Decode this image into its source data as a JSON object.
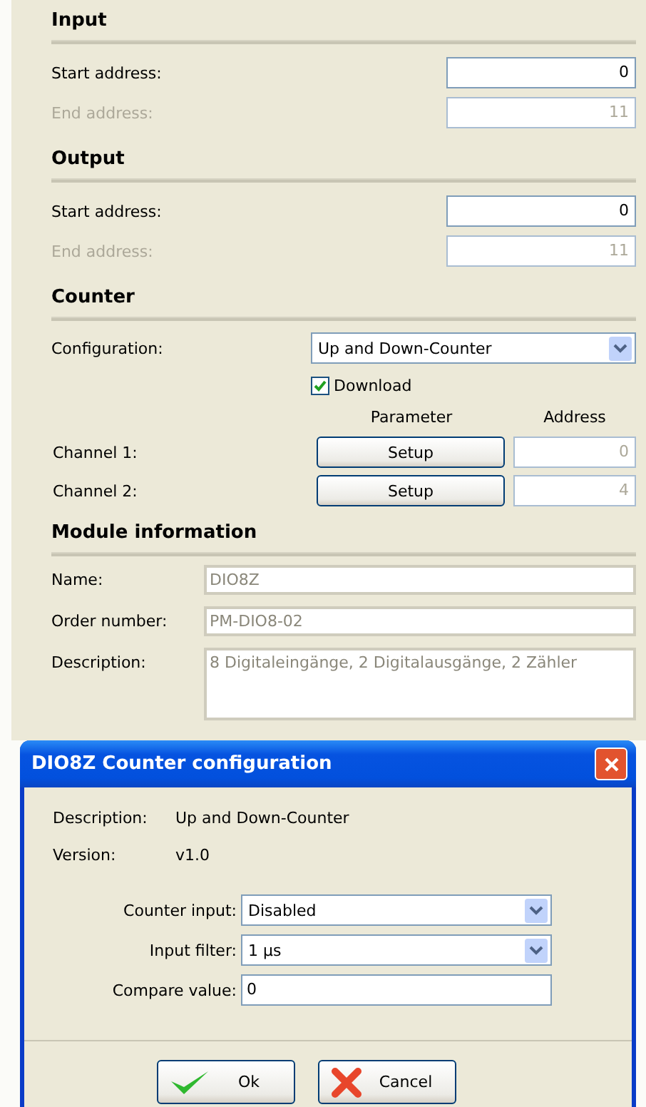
{
  "input": {
    "title": "Input",
    "rows": [
      {
        "label": "Start address:",
        "value": "0",
        "disabled": false
      },
      {
        "label": "End address:",
        "value": "11",
        "disabled": true
      }
    ]
  },
  "output": {
    "title": "Output",
    "rows": [
      {
        "label": "Start address:",
        "value": "0",
        "disabled": false
      },
      {
        "label": "End address:",
        "value": "11",
        "disabled": true
      }
    ]
  },
  "counter": {
    "title": "Counter",
    "configuration": {
      "label": "Configuration:",
      "value": "Up and Down-Counter"
    },
    "download": {
      "label": "Download",
      "checked": true
    },
    "headers": [
      "Parameter",
      "Address"
    ],
    "channels": [
      {
        "label": "Channel 1:",
        "button": "Setup",
        "address": "0"
      },
      {
        "label": "Channel 2:",
        "button": "Setup",
        "address": "4"
      }
    ]
  },
  "module_information": {
    "title": "Module information",
    "fields": [
      {
        "label": "Name:",
        "value": "DIO8Z",
        "kind": "line"
      },
      {
        "label": "Order number:",
        "value": "PM-DIO8-02",
        "kind": "line"
      },
      {
        "label": "Description:",
        "value": "8 Digitaleingänge, 2 Digitalausgänge, 2 Zähler",
        "kind": "area"
      }
    ]
  },
  "dialog": {
    "title": "DIO8Z Counter configuration",
    "info": [
      {
        "label": "Description:",
        "value": "Up and Down-Counter"
      },
      {
        "label": "Version:",
        "value": "v1.0"
      }
    ],
    "fields": [
      {
        "label": "Counter input:",
        "value": "Disabled",
        "kind": "select"
      },
      {
        "label": "Input filter:",
        "value": "1 µs",
        "kind": "select"
      },
      {
        "label": "Compare value:",
        "value": "0",
        "kind": "text"
      }
    ],
    "buttons": [
      {
        "label": "Ok",
        "kind": "ok"
      },
      {
        "label": "Cancel",
        "kind": "cancel"
      }
    ]
  }
}
